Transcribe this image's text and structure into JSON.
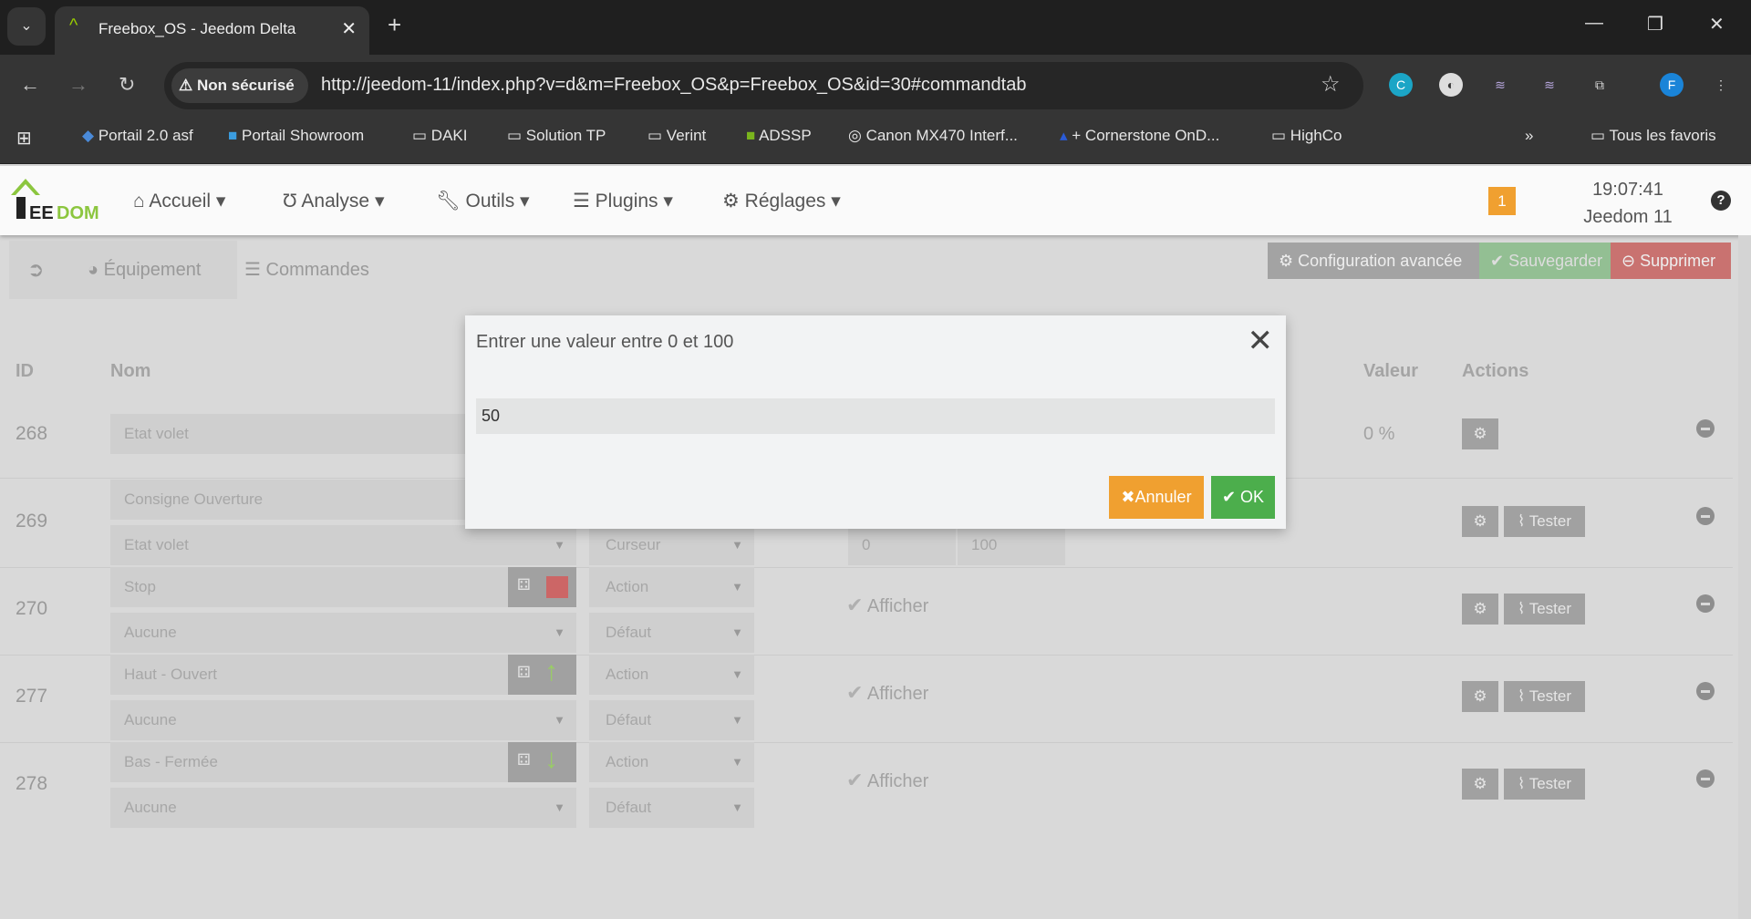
{
  "browser": {
    "tab_title": "Freebox_OS - Jeedom Delta",
    "security_label": "Non sécurisé",
    "url": "http://jeedom-11/index.php?v=d&m=Freebox_OS&p=Freebox_OS&id=30#commandtab",
    "profile_initial": "F",
    "bookmarks": [
      "Portail 2.0 asf",
      "Portail Showroom",
      "DAKI",
      "Solution TP",
      "Verint",
      "ADSSP",
      "Canon MX470 Interf...",
      "+ Cornerstone OnD...",
      "HighCo"
    ],
    "all_bookmarks": "Tous les favoris"
  },
  "header": {
    "menu": [
      "Accueil",
      "Analyse",
      "Outils",
      "Plugins",
      "Réglages"
    ],
    "notif_count": "1",
    "time": "19:07:41",
    "hostname": "Jeedom 11"
  },
  "subnav": {
    "tabs": [
      "Équipement",
      "Commandes"
    ],
    "config_label": "Configuration avancée",
    "save_label": "Sauvegarder",
    "delete_label": "Supprimer"
  },
  "table": {
    "headers": {
      "id": "ID",
      "name": "Nom",
      "value": "Valeur",
      "actions": "Actions"
    },
    "rows": [
      {
        "id": "268",
        "name": "Etat volet",
        "value": "0 %"
      },
      {
        "id": "269",
        "name": "Consigne Ouverture",
        "info": "Etat volet",
        "subtype": "Curseur",
        "min": "0",
        "max": "100",
        "test": "Tester"
      },
      {
        "id": "270",
        "name": "Stop",
        "info": "Aucune",
        "type": "Action",
        "subtype": "Défaut",
        "show": "Afficher",
        "test": "Tester"
      },
      {
        "id": "277",
        "name": "Haut - Ouvert",
        "info": "Aucune",
        "type": "Action",
        "subtype": "Défaut",
        "show": "Afficher",
        "test": "Tester"
      },
      {
        "id": "278",
        "name": "Bas - Fermée",
        "info": "Aucune",
        "type": "Action",
        "subtype": "Défaut",
        "show": "Afficher",
        "test": "Tester"
      }
    ]
  },
  "dialog": {
    "title": "Entrer une valeur entre 0 et 100",
    "value": "50",
    "cancel_label": "Annuler",
    "ok_label": "OK"
  },
  "colors": {
    "orange": "#f0a030",
    "green": "#4cae4c",
    "red": "#d9534f"
  }
}
